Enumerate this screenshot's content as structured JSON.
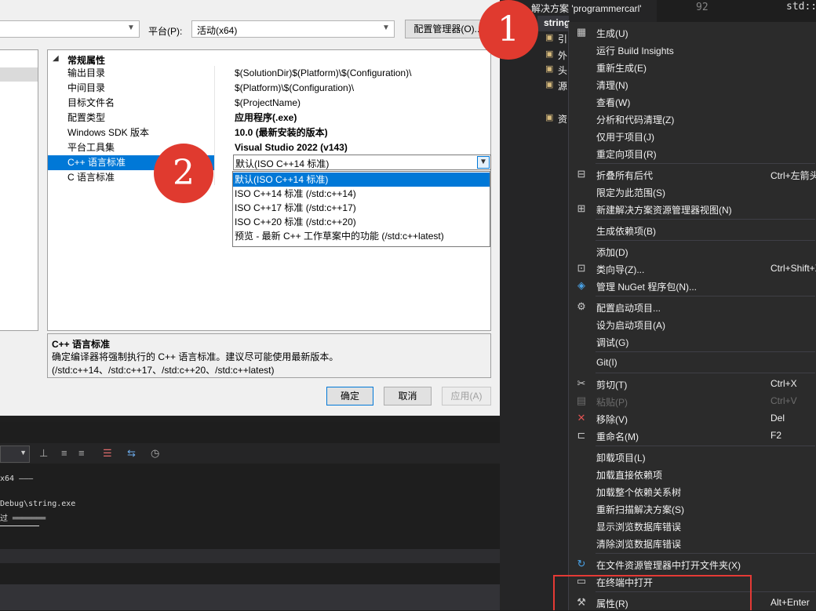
{
  "dialog": {
    "platform_label": "平台(P):",
    "platform_value": "活动(x64)",
    "config_manager_button": "配置管理器(O)...",
    "category": "常规属性",
    "properties": [
      {
        "name": "输出目录",
        "value": "$(SolutionDir)$(Platform)\\$(Configuration)\\",
        "bold": false
      },
      {
        "name": "中间目录",
        "value": "$(Platform)\\$(Configuration)\\",
        "bold": false
      },
      {
        "name": "目标文件名",
        "value": "$(ProjectName)",
        "bold": false
      },
      {
        "name": "配置类型",
        "value": "应用程序(.exe)",
        "bold": true
      },
      {
        "name": "Windows SDK 版本",
        "value": "10.0 (最新安装的版本)",
        "bold": true
      },
      {
        "name": "平台工具集",
        "value": "Visual Studio 2022 (v143)",
        "bold": true
      },
      {
        "name": "C++ 语言标准",
        "value": "",
        "bold": false
      },
      {
        "name": "C 语言标准",
        "value": "",
        "bold": false
      }
    ],
    "cpp_std_current": "默认(ISO C++14 标准)",
    "cpp_std_options": [
      "默认(ISO C++14 标准)",
      "ISO C++14 标准 (/std:c++14)",
      "ISO C++17 标准 (/std:c++17)",
      "ISO C++20 标准 (/std:c++20)",
      "预览 - 最新 C++ 工作草案中的功能 (/std:c++latest)"
    ],
    "selected_option_index": 0,
    "desc_title": "C++ 语言标准",
    "desc_text": "确定编译器将强制执行的 C++ 语言标准。建议尽可能使用最新版本。(/std:c++14、/std:c++17、/std:c++20、/std:c++latest)",
    "ok_button": "确定",
    "cancel_button": "取消",
    "apply_button": "应用(A)"
  },
  "output": {
    "line1": "x64 ———",
    "line2": "Debug\\string.exe",
    "line3": "过 ═══════"
  },
  "solution_explorer": {
    "title": "解决方案 'programmercarl'",
    "project": "string",
    "items": [
      "引",
      "外",
      "头",
      "源",
      "资"
    ]
  },
  "code": {
    "line_number": "92",
    "snippet": "std::"
  },
  "context_menu": {
    "items": [
      {
        "icon": "build-icon",
        "label": "生成(U)",
        "shortcut": "",
        "disabled": false
      },
      {
        "icon": "",
        "label": "运行 Build Insights",
        "shortcut": "",
        "disabled": false
      },
      {
        "icon": "",
        "label": "重新生成(E)",
        "shortcut": "",
        "disabled": false
      },
      {
        "icon": "",
        "label": "清理(N)",
        "shortcut": "",
        "disabled": false
      },
      {
        "icon": "",
        "label": "查看(W)",
        "shortcut": "",
        "disabled": false
      },
      {
        "icon": "",
        "label": "分析和代码清理(Z)",
        "shortcut": "",
        "disabled": false
      },
      {
        "icon": "",
        "label": "仅用于项目(J)",
        "shortcut": "",
        "disabled": false
      },
      {
        "icon": "",
        "label": "重定向项目(R)",
        "shortcut": "",
        "disabled": false
      },
      {
        "sep": true
      },
      {
        "icon": "collapse-icon",
        "label": "折叠所有后代",
        "shortcut": "Ctrl+左箭头",
        "disabled": false
      },
      {
        "icon": "",
        "label": "限定为此范围(S)",
        "shortcut": "",
        "disabled": false
      },
      {
        "icon": "new-view-icon",
        "label": "新建解决方案资源管理器视图(N)",
        "shortcut": "",
        "disabled": false
      },
      {
        "sep": true
      },
      {
        "icon": "",
        "label": "生成依赖项(B)",
        "shortcut": "",
        "disabled": false
      },
      {
        "sep": true
      },
      {
        "icon": "",
        "label": "添加(D)",
        "shortcut": "",
        "disabled": false
      },
      {
        "icon": "class-wizard-icon",
        "label": "类向导(Z)...",
        "shortcut": "Ctrl+Shift+X",
        "disabled": false
      },
      {
        "icon": "nuget-icon",
        "label": "管理 NuGet 程序包(N)...",
        "shortcut": "",
        "disabled": false
      },
      {
        "sep": true
      },
      {
        "icon": "gear-icon",
        "label": "配置启动项目...",
        "shortcut": "",
        "disabled": false
      },
      {
        "icon": "",
        "label": "设为启动项目(A)",
        "shortcut": "",
        "disabled": false
      },
      {
        "icon": "",
        "label": "调试(G)",
        "shortcut": "",
        "disabled": false
      },
      {
        "sep": true
      },
      {
        "icon": "",
        "label": "Git(I)",
        "shortcut": "",
        "disabled": false
      },
      {
        "sep": true
      },
      {
        "icon": "scissors-icon",
        "label": "剪切(T)",
        "shortcut": "Ctrl+X",
        "disabled": false
      },
      {
        "icon": "paste-icon",
        "label": "粘贴(P)",
        "shortcut": "Ctrl+V",
        "disabled": true
      },
      {
        "icon": "delete-icon",
        "label": "移除(V)",
        "shortcut": "Del",
        "disabled": false
      },
      {
        "icon": "rename-icon",
        "label": "重命名(M)",
        "shortcut": "F2",
        "disabled": false
      },
      {
        "sep": true
      },
      {
        "icon": "",
        "label": "卸载项目(L)",
        "shortcut": "",
        "disabled": false
      },
      {
        "icon": "",
        "label": "加载直接依赖项",
        "shortcut": "",
        "disabled": false
      },
      {
        "icon": "",
        "label": "加载整个依赖关系树",
        "shortcut": "",
        "disabled": false
      },
      {
        "icon": "",
        "label": "重新扫描解决方案(S)",
        "shortcut": "",
        "disabled": false
      },
      {
        "icon": "",
        "label": "显示浏览数据库错误",
        "shortcut": "",
        "disabled": false
      },
      {
        "icon": "",
        "label": "清除浏览数据库错误",
        "shortcut": "",
        "disabled": false
      },
      {
        "sep": true
      },
      {
        "icon": "open-folder-icon",
        "label": "在文件资源管理器中打开文件夹(X)",
        "shortcut": "",
        "disabled": false
      },
      {
        "icon": "terminal-icon",
        "label": "在终端中打开",
        "shortcut": "",
        "disabled": false
      },
      {
        "sep": true
      },
      {
        "icon": "wrench-icon",
        "label": "属性(R)",
        "shortcut": "Alt+Enter",
        "disabled": false
      }
    ]
  },
  "annotations": {
    "marker_1": "1",
    "marker_2": "2",
    "marker_color": "#e03a2f",
    "highlight_color": "#e43a35"
  }
}
